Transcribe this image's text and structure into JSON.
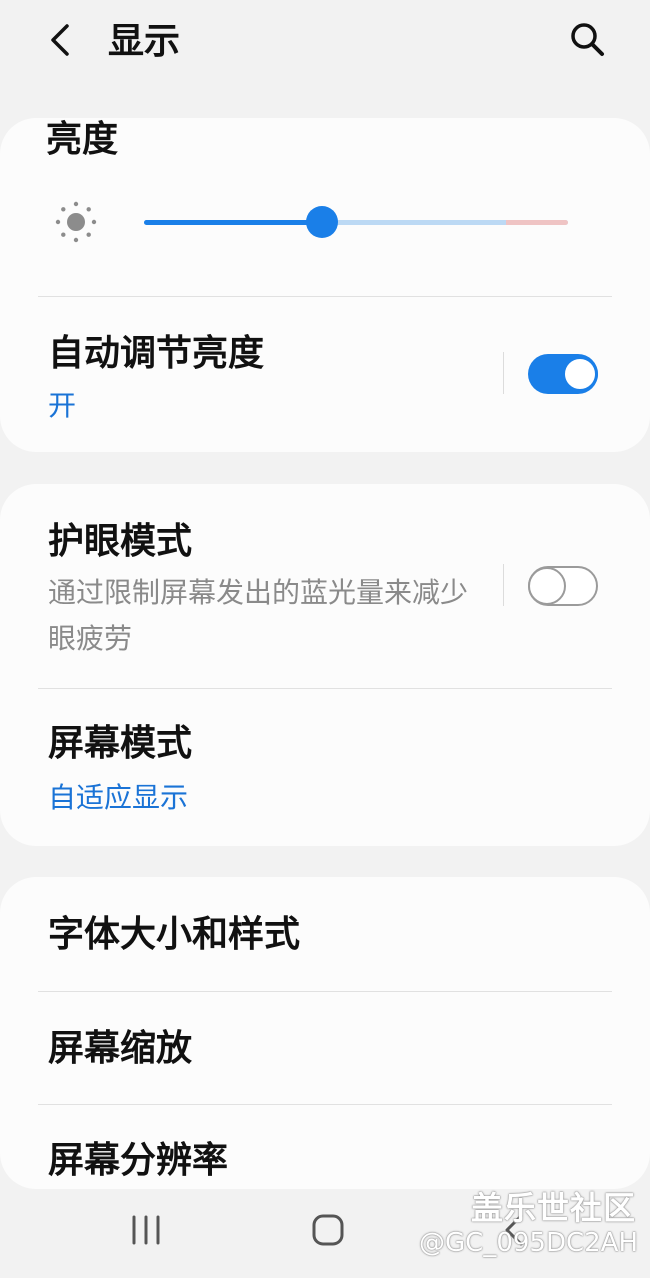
{
  "header": {
    "title": "显示",
    "back_icon": "chevron-left-icon",
    "search_icon": "search-icon"
  },
  "brightness_card": {
    "title": "亮度",
    "slider": {
      "level": 0.42,
      "sun_icon": "sun-icon"
    },
    "adaptive": {
      "title": "自动调节亮度",
      "status": "开",
      "enabled": true
    }
  },
  "eye_card": {
    "eye_comfort": {
      "title": "护眼模式",
      "description": "通过限制屏幕发出的蓝光量来减少眼疲劳",
      "enabled": false
    },
    "screen_mode": {
      "title": "屏幕模式",
      "value": "自适应显示"
    }
  },
  "font_card": {
    "items": [
      {
        "label": "字体大小和样式"
      },
      {
        "label": "屏幕缩放"
      },
      {
        "label": "屏幕分辨率"
      }
    ]
  },
  "navbar": {
    "recents_icon": "recent-apps-icon",
    "home_icon": "home-icon",
    "back_icon": "nav-back-icon"
  },
  "watermark": {
    "title": "盖乐世社区",
    "id": "@GC_095DC2AH"
  },
  "colors": {
    "accent": "#1a7fe8",
    "accent_text": "#1a73d6",
    "background": "#f2f2f2",
    "card": "#fcfcfc"
  }
}
